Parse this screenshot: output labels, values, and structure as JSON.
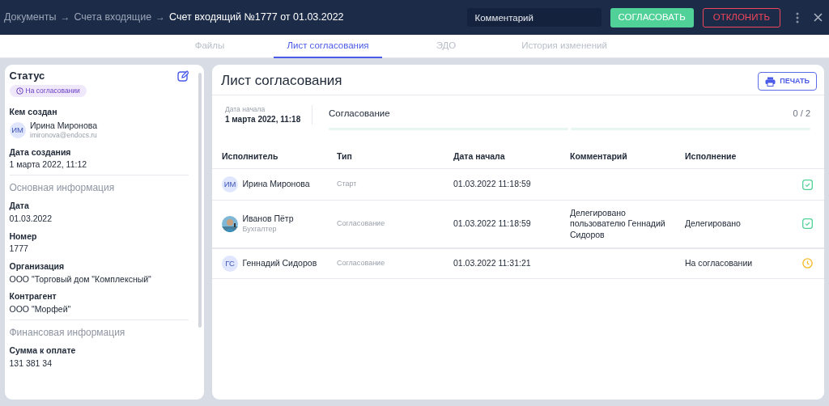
{
  "header": {
    "breadcrumbs": [
      {
        "label": "Документы",
        "current": false
      },
      {
        "label": "Счета входящие",
        "current": false
      },
      {
        "label": "Счет входящий №1777 от 01.03.2022",
        "current": true
      }
    ],
    "separator": "→",
    "comment": {
      "placeholder": "Комментарий"
    },
    "approve": "СОГЛАСОВАТЬ",
    "reject": "ОТКЛОНИТЬ"
  },
  "tabs": [
    {
      "label": "Файлы",
      "selected": false
    },
    {
      "label": "Лист согласования",
      "selected": true
    },
    {
      "label": "ЭДО",
      "selected": false
    },
    {
      "label": "История изменений",
      "selected": false
    }
  ],
  "sidebar": {
    "title": "Статус",
    "status": "На согласовании",
    "created_by": {
      "label": "Кем создан",
      "initials": "ИМ",
      "name": "Ирина Миронова",
      "email": "imironova@endocs.ru"
    },
    "created_date": {
      "label": "Дата создания",
      "value": "1 марта 2022, 11:12"
    },
    "sections": [
      {
        "title": "Основная информация",
        "fields": [
          {
            "label": "Дата",
            "value": "01.03.2022"
          },
          {
            "label": "Номер",
            "value": "1777"
          },
          {
            "label": "Организация",
            "value": "ООО \"Торговый дом \"Комплексный\""
          },
          {
            "label": "Контрагент",
            "value": "ООО \"Морфей\""
          }
        ]
      },
      {
        "title": "Финансовая информация",
        "fields": [
          {
            "label": "Сумма к оплате",
            "value": "131 381 34"
          }
        ]
      }
    ]
  },
  "main": {
    "title": "Лист согласования",
    "print": "ПЕЧАТЬ",
    "start": {
      "label": "Дата начала",
      "value": "1 марта 2022, 11:18"
    },
    "stage": {
      "name": "Согласование",
      "reading": "0 / 2",
      "steps": [
        {
          "done": false
        },
        {
          "done": false
        }
      ]
    },
    "table": {
      "columns": [
        "Исполнитель",
        "Тип",
        "Дата начала",
        "Комментарий",
        "Исполнение"
      ],
      "rows": [
        {
          "avatar": {
            "kind": "initials",
            "text": "ИМ"
          },
          "name": "Ирина Миронова",
          "type": "Старт",
          "date": "01.03.2022 11:18:59",
          "kind": "done"
        },
        {
          "name": "Иванов Пётр",
          "role": "Бухгалтер",
          "type": "Согласование",
          "date": "01.03.2022 11:18:59",
          "comment": "Делегировано пользователю Геннадий Сидоров",
          "result": "Делегировано",
          "kind": "done"
        },
        {
          "avatar": {
            "kind": "initials",
            "text": "ГС"
          },
          "name": "Геннадий Сидоров",
          "type": "Согласование",
          "date": "01.03.2022 11:31:21",
          "result": "На согласовании",
          "kind": "pending"
        }
      ]
    }
  }
}
